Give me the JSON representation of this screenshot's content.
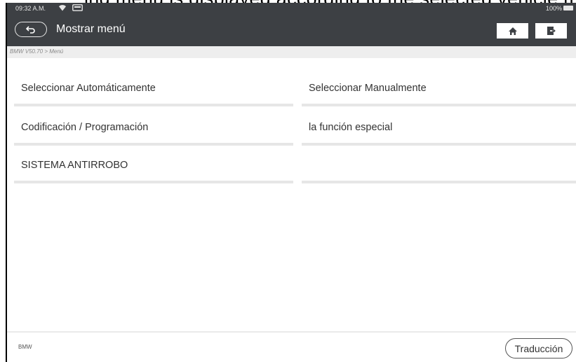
{
  "caption_clip": "ing menu is displayed according to the selected vehicle model and version",
  "status_bar": {
    "time": "09:32 A.M.",
    "wifi_icon": "wifi-icon",
    "vci_icon": "vci-connector-icon",
    "battery_text": "100%",
    "battery_icon": "battery-icon"
  },
  "header": {
    "back_icon": "back-arrow-icon",
    "title": "Mostrar menú",
    "home_icon": "home-icon",
    "exit_icon": "exit-icon"
  },
  "breadcrumb": "BMW V50.70 > Menú",
  "menu_items": [
    {
      "label": "Seleccionar Automáticamente"
    },
    {
      "label": "Seleccionar Manualmente"
    },
    {
      "label": "Codificación / Programación"
    },
    {
      "label": "la función especial"
    },
    {
      "label": "SISTEMA ANTIRROBO"
    },
    {
      "label": ""
    }
  ],
  "footer": {
    "brand": "BMW",
    "translate_label": "Traducción"
  },
  "colors": {
    "header_bg": "#3d4044",
    "breadcrumb_bg": "#eeeeee",
    "item_separator": "#e6e6e6"
  }
}
